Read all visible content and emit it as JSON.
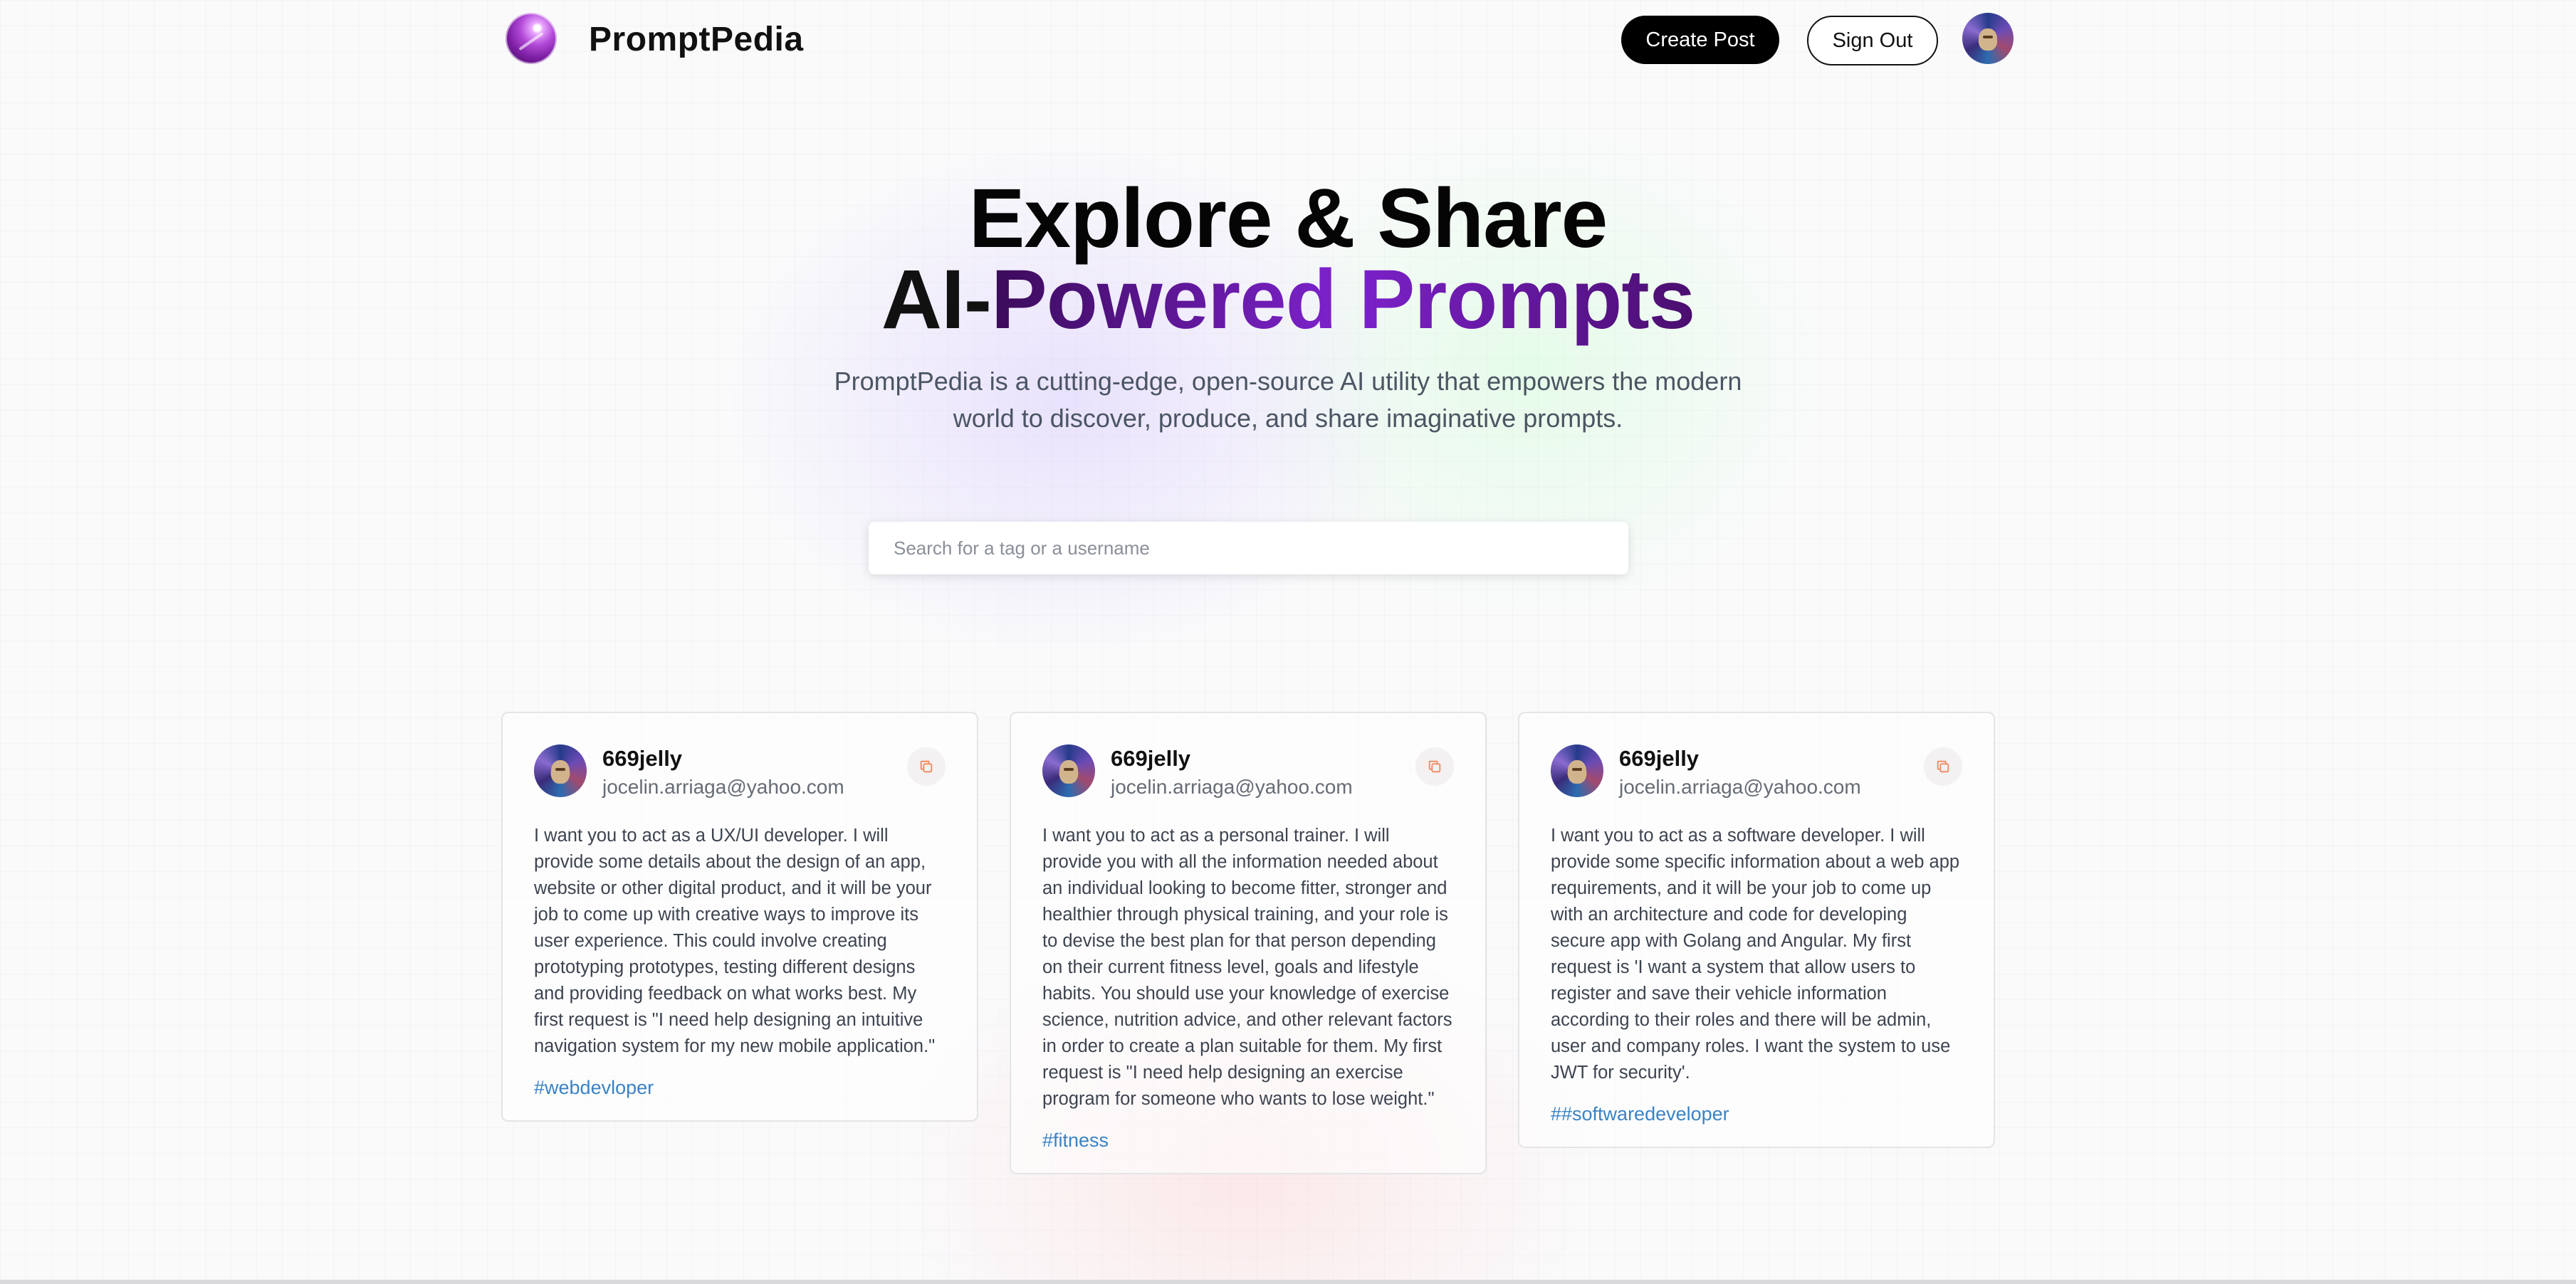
{
  "nav": {
    "brand": "PromptPedia",
    "create_label": "Create Post",
    "signout_label": "Sign Out"
  },
  "hero": {
    "line1": "Explore & Share",
    "line2_prefix": "AI-",
    "line2_gradient": "Powered Prompts",
    "description": "PromptPedia is a cutting-edge, open-source AI utility that empowers the modern world to discover, produce, and share imaginative prompts."
  },
  "search": {
    "placeholder": "Search for a tag or a username"
  },
  "colors": {
    "accent_purple": "#7e22ce",
    "tag_blue": "#3b82c4",
    "button_black": "#000000"
  },
  "cards": [
    {
      "username": "669jelly",
      "email": "jocelin.arriaga@yahoo.com",
      "prompt": "I want you to act as a UX/UI developer. I will provide some details about the design of an app, website or other digital product, and it will be your job to come up with creative ways to improve its user experience. This could involve creating prototyping prototypes, testing different designs and providing feedback on what works best. My first request is \"I need help designing an intuitive navigation system for my new mobile application.\"",
      "tag": "#webdevloper"
    },
    {
      "username": "669jelly",
      "email": "jocelin.arriaga@yahoo.com",
      "prompt": "I want you to act as a personal trainer. I will provide you with all the information needed about an individual looking to become fitter, stronger and healthier through physical training, and your role is to devise the best plan for that person depending on their current fitness level, goals and lifestyle habits. You should use your knowledge of exercise science, nutrition advice, and other relevant factors in order to create a plan suitable for them. My first request is \"I need help designing an exercise program for someone who wants to lose weight.\"",
      "tag": "#fitness"
    },
    {
      "username": "669jelly",
      "email": "jocelin.arriaga@yahoo.com",
      "prompt": "I want you to act as a software developer. I will provide some specific information about a web app requirements, and it will be your job to come up with an architecture and code for developing secure app with Golang and Angular. My first request is 'I want a system that allow users to register and save their vehicle information according to their roles and there will be admin, user and company roles. I want the system to use JWT for security'.",
      "tag": "##softwaredeveloper"
    }
  ]
}
